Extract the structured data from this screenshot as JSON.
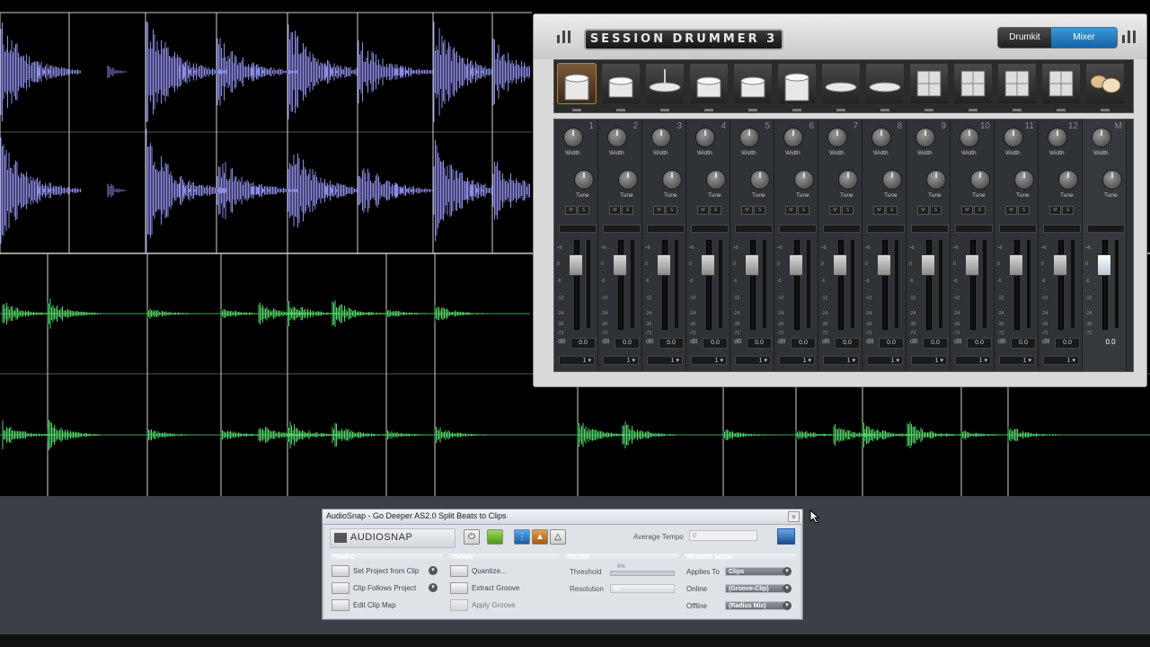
{
  "session_drummer": {
    "logo_text": "SESSION DRUMMER 3",
    "tabs": [
      {
        "label": "Drumkit",
        "active": false
      },
      {
        "label": "Mixer",
        "active": true
      }
    ],
    "drums": [
      "kick",
      "snare",
      "hihat",
      "tom",
      "tom",
      "floor-tom",
      "cymbal",
      "cymbal",
      "pad",
      "pad",
      "pad",
      "pad",
      "kit"
    ],
    "channels": [
      {
        "num": "1",
        "width_label": "Width",
        "tune_label": "Tune",
        "m": "M",
        "s": "S",
        "value": "0.0",
        "out": "1"
      },
      {
        "num": "2",
        "width_label": "Width",
        "tune_label": "Tune",
        "m": "M",
        "s": "S",
        "value": "0.0",
        "out": "1"
      },
      {
        "num": "3",
        "width_label": "Width",
        "tune_label": "Tune",
        "m": "M",
        "s": "S",
        "value": "0.0",
        "out": "1"
      },
      {
        "num": "4",
        "width_label": "Width",
        "tune_label": "Tune",
        "m": "M",
        "s": "S",
        "value": "0.0",
        "out": "1"
      },
      {
        "num": "5",
        "width_label": "Width",
        "tune_label": "Tune",
        "m": "M",
        "s": "S",
        "value": "0.0",
        "out": "1"
      },
      {
        "num": "6",
        "width_label": "Width",
        "tune_label": "Tune",
        "m": "M",
        "s": "S",
        "value": "0.0",
        "out": "1"
      },
      {
        "num": "7",
        "width_label": "Width",
        "tune_label": "Tune",
        "m": "M",
        "s": "S",
        "value": "0.0",
        "out": "1"
      },
      {
        "num": "8",
        "width_label": "Width",
        "tune_label": "Tune",
        "m": "M",
        "s": "S",
        "value": "0.0",
        "out": "1"
      },
      {
        "num": "9",
        "width_label": "Width",
        "tune_label": "Tune",
        "m": "M",
        "s": "S",
        "value": "0.0",
        "out": "1"
      },
      {
        "num": "10",
        "width_label": "Width",
        "tune_label": "Tune",
        "m": "M",
        "s": "S",
        "value": "0.0",
        "out": "1"
      },
      {
        "num": "11",
        "width_label": "Width",
        "tune_label": "Tune",
        "m": "M",
        "s": "S",
        "value": "0.0",
        "out": "1"
      },
      {
        "num": "12",
        "width_label": "Width",
        "tune_label": "Tune",
        "m": "M",
        "s": "S",
        "value": "0.0",
        "out": "1"
      }
    ],
    "master": {
      "num": "M",
      "width_label": "Width",
      "tune_label": "Tune",
      "value": "0.0"
    },
    "scale": [
      "+6",
      "0",
      "-6",
      "-12",
      "-24",
      "-36",
      "-72"
    ],
    "db_label": "dB"
  },
  "audiosnap": {
    "title": "AudioSnap - Go Deeper AS2.0 Split Beats to Clips",
    "logo_text": "AUDIOSNAP",
    "average_tempo_label": "Average Tempo",
    "average_tempo_value": "0",
    "sections": {
      "tempo": "TEMPO",
      "timing": "TIMING",
      "filter": "FILTER",
      "render": "RENDER MODE"
    },
    "tempo_items": [
      "Set Project from Clip",
      "Clip Follows Project",
      "Edit Clip Map"
    ],
    "timing_items": [
      "Quantize...",
      "Extract Groove",
      "Apply Groove"
    ],
    "filter": {
      "threshold_label": "Threshold",
      "threshold_value": "0%",
      "resolution_label": "Resolution",
      "resolution_value": "All"
    },
    "render": {
      "applies_to_label": "Applies To",
      "applies_to_value": "Clips",
      "online_label": "Online",
      "online_value": "(Groove-Clip)",
      "offline_label": "Offline",
      "offline_value": "(Radius Mix)"
    }
  },
  "colors": {
    "drum_wave": "#8c8ce6",
    "perc_wave": "#52d468",
    "mixer_active_tab": "#1f74bb"
  }
}
